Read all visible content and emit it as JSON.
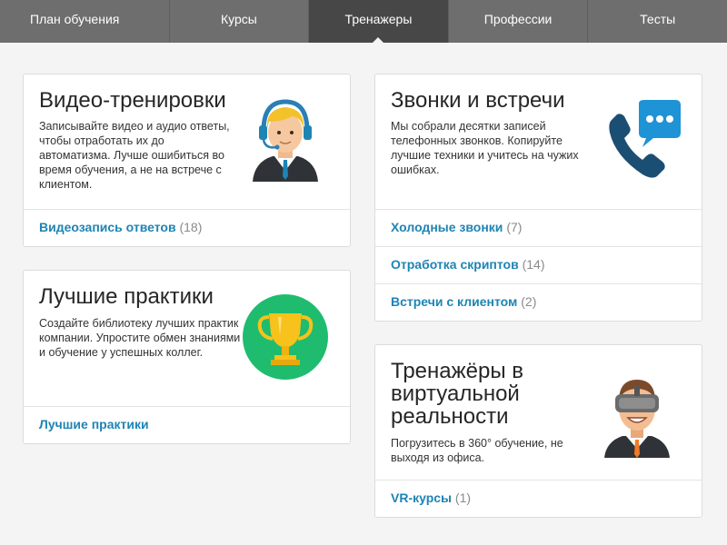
{
  "nav": {
    "tabs": [
      {
        "label": "План обучения"
      },
      {
        "label": "Курсы"
      },
      {
        "label": "Тренажеры",
        "active": true
      },
      {
        "label": "Профессии"
      },
      {
        "label": "Тесты"
      }
    ]
  },
  "cards": {
    "video": {
      "title": "Видео-тренировки",
      "desc": "Записывайте видео и аудио ответы, чтобы отработать их до автоматизма. Лучше ошибиться во время обучения, а не на встрече с клиентом.",
      "links": [
        {
          "label": "Видеозапись ответов",
          "count": "(18)"
        }
      ]
    },
    "practices": {
      "title": "Лучшие практики",
      "desc": "Создайте библиотеку лучших практик компании. Упростите обмен знаниями и обучение у успешных коллег.",
      "links": [
        {
          "label": "Лучшие практики",
          "count": ""
        }
      ]
    },
    "calls": {
      "title": "Звонки и встречи",
      "desc": "Мы собрали десятки записей телефонных звонков. Копируйте лучшие техники и учитесь на чужих ошибках.",
      "links": [
        {
          "label": "Холодные звонки",
          "count": "(7)"
        },
        {
          "label": "Отработка скриптов",
          "count": "(14)"
        },
        {
          "label": "Встречи с клиентом",
          "count": "(2)"
        }
      ]
    },
    "vr": {
      "title": "Тренажёры в виртуальной реальности",
      "desc": "Погрузитесь в 360° обучение, не выходя из офиса.",
      "links": [
        {
          "label": "VR-курсы",
          "count": "(1)"
        }
      ]
    }
  },
  "icons": {
    "video": "headset-operator-icon",
    "practices": "trophy-icon",
    "calls": "phone-chat-icon",
    "vr": "vr-headset-person-icon"
  },
  "colors": {
    "nav_bg": "#6e6e6e",
    "nav_active": "#474747",
    "link": "#1e84b4",
    "trophy_bg": "#1fbc6f",
    "trophy": "#f7c21b",
    "phone": "#1b4e73",
    "chat": "#1e93d6"
  }
}
